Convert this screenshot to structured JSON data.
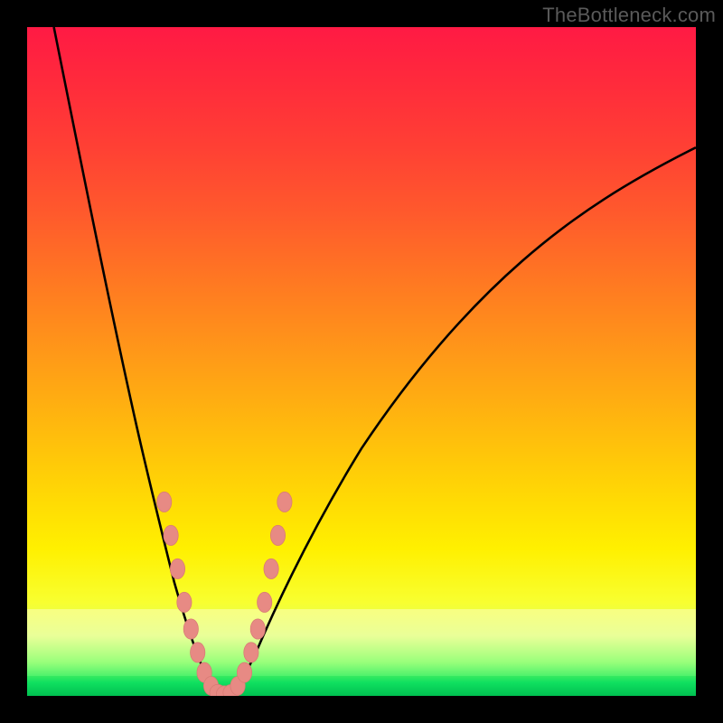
{
  "watermark": "TheBottleneck.com",
  "chart_data": {
    "type": "line",
    "title": "",
    "xlabel": "",
    "ylabel": "",
    "xlim": [
      0,
      100
    ],
    "ylim": [
      0,
      100
    ],
    "background_gradient_stops": [
      {
        "pos": 0,
        "color": "#ff1a44"
      },
      {
        "pos": 8,
        "color": "#ff2a3c"
      },
      {
        "pos": 18,
        "color": "#ff4034"
      },
      {
        "pos": 28,
        "color": "#ff5a2c"
      },
      {
        "pos": 38,
        "color": "#ff7822"
      },
      {
        "pos": 48,
        "color": "#ff9619"
      },
      {
        "pos": 58,
        "color": "#ffb40f"
      },
      {
        "pos": 68,
        "color": "#ffd206"
      },
      {
        "pos": 78,
        "color": "#fff000"
      },
      {
        "pos": 86,
        "color": "#f8ff30"
      },
      {
        "pos": 91,
        "color": "#d8ff60"
      },
      {
        "pos": 95,
        "color": "#88ff60"
      },
      {
        "pos": 98,
        "color": "#10e060"
      },
      {
        "pos": 100,
        "color": "#00c050"
      }
    ],
    "series": [
      {
        "name": "bottleneck-curve-left",
        "x": [
          4,
          6,
          8,
          10,
          12,
          14,
          16,
          18,
          20,
          22,
          24,
          25,
          26,
          27,
          28
        ],
        "values": [
          100,
          90,
          80,
          70,
          60,
          51,
          42,
          33,
          25,
          17,
          10,
          6,
          3,
          1,
          0
        ]
      },
      {
        "name": "bottleneck-curve-right",
        "x": [
          30,
          31,
          32,
          34,
          36,
          40,
          45,
          50,
          55,
          60,
          65,
          70,
          75,
          80,
          85,
          90,
          95,
          100
        ],
        "values": [
          0,
          1,
          3,
          7,
          11,
          19,
          29,
          37,
          45,
          52,
          58,
          63,
          68,
          72,
          75,
          78,
          80,
          82
        ]
      }
    ],
    "markers": {
      "name": "salmon-dots",
      "color": "#e78a84",
      "points": [
        {
          "x": 20.5,
          "y": 29
        },
        {
          "x": 21.5,
          "y": 24
        },
        {
          "x": 22.5,
          "y": 19
        },
        {
          "x": 23.5,
          "y": 14
        },
        {
          "x": 24.5,
          "y": 10
        },
        {
          "x": 25.5,
          "y": 6.5
        },
        {
          "x": 26.5,
          "y": 3.5
        },
        {
          "x": 27.5,
          "y": 1.5
        },
        {
          "x": 28.5,
          "y": 0.5
        },
        {
          "x": 29.5,
          "y": 0.3
        },
        {
          "x": 30.5,
          "y": 0.5
        },
        {
          "x": 31.5,
          "y": 1.5
        },
        {
          "x": 32.5,
          "y": 3.5
        },
        {
          "x": 33.5,
          "y": 6.5
        },
        {
          "x": 34.5,
          "y": 10
        },
        {
          "x": 35.5,
          "y": 14
        },
        {
          "x": 36.5,
          "y": 19
        },
        {
          "x": 37.5,
          "y": 24
        },
        {
          "x": 38.5,
          "y": 29
        }
      ]
    }
  }
}
